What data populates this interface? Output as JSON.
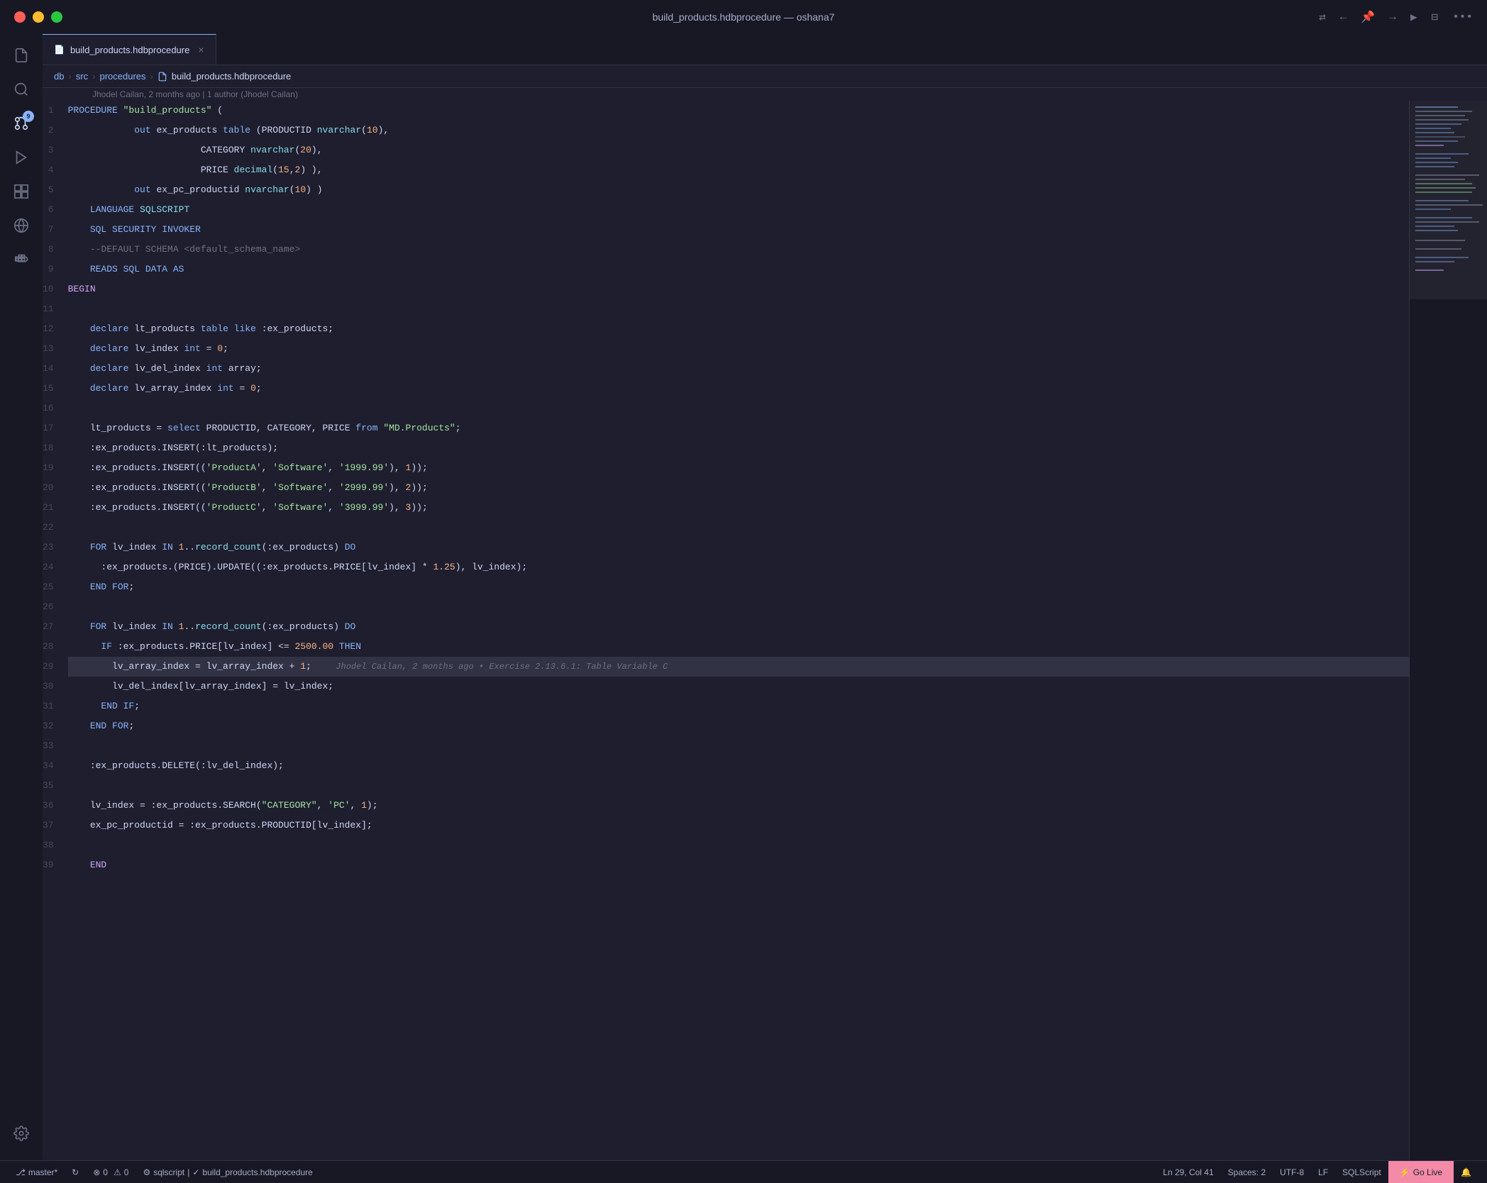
{
  "titlebar": {
    "title": "build_products.hdbprocedure — oshana7",
    "icons": [
      "git-compare",
      "go-back",
      "pin",
      "go-forward",
      "play",
      "split-editor",
      "more"
    ]
  },
  "activity_bar": {
    "icons": [
      {
        "name": "files",
        "symbol": "⎗",
        "active": false
      },
      {
        "name": "search",
        "symbol": "🔍",
        "active": false
      },
      {
        "name": "source-control",
        "symbol": "⎇",
        "active": true,
        "badge": "9"
      },
      {
        "name": "run-debug",
        "symbol": "▶",
        "active": false
      },
      {
        "name": "extensions",
        "symbol": "⊞",
        "active": false
      },
      {
        "name": "remote-explorer",
        "symbol": "○",
        "active": false
      },
      {
        "name": "docker",
        "symbol": "🐳",
        "active": false
      }
    ],
    "bottom_icons": [
      {
        "name": "settings",
        "symbol": "⚙"
      }
    ]
  },
  "tab": {
    "filename": "build_products.hdbprocedure",
    "icon": "📄",
    "modified": false
  },
  "breadcrumb": {
    "items": [
      "db",
      "src",
      "procedures",
      "build_products.hdbprocedure"
    ]
  },
  "blame": {
    "text": "Jhodel Cailan, 2 months ago | 1 author (Jhodel Cailan)"
  },
  "code": {
    "lines": [
      {
        "num": 1,
        "tokens": [
          {
            "t": "kw",
            "v": "PROCEDURE "
          },
          {
            "t": "str",
            "v": "\"build_products\""
          },
          {
            "t": "plain",
            "v": " ("
          }
        ]
      },
      {
        "num": 2,
        "tokens": [
          {
            "t": "plain",
            "v": "            "
          },
          {
            "t": "kw",
            "v": "out "
          },
          {
            "t": "plain",
            "v": "ex_products "
          },
          {
            "t": "kw",
            "v": "table "
          },
          {
            "t": "plain",
            "v": "(PRODUCTID "
          },
          {
            "t": "fn",
            "v": "nvarchar"
          },
          {
            "t": "plain",
            "v": "("
          },
          {
            "t": "num",
            "v": "10"
          },
          {
            "t": "plain",
            "v": "),"
          }
        ]
      },
      {
        "num": 3,
        "tokens": [
          {
            "t": "plain",
            "v": "                        CATEGORY "
          },
          {
            "t": "fn",
            "v": "nvarchar"
          },
          {
            "t": "plain",
            "v": "("
          },
          {
            "t": "num",
            "v": "20"
          },
          {
            "t": "plain",
            "v": "),"
          }
        ]
      },
      {
        "num": 4,
        "tokens": [
          {
            "t": "plain",
            "v": "                        PRICE "
          },
          {
            "t": "fn",
            "v": "decimal"
          },
          {
            "t": "plain",
            "v": "("
          },
          {
            "t": "num",
            "v": "15"
          },
          {
            "t": "plain",
            "v": ","
          },
          {
            "t": "num",
            "v": "2"
          },
          {
            "t": "plain",
            "v": "} ),"
          }
        ]
      },
      {
        "num": 5,
        "tokens": [
          {
            "t": "plain",
            "v": "            "
          },
          {
            "t": "kw",
            "v": "out "
          },
          {
            "t": "plain",
            "v": "ex_pc_productid "
          },
          {
            "t": "fn",
            "v": "nvarchar"
          },
          {
            "t": "plain",
            "v": "("
          },
          {
            "t": "num",
            "v": "10"
          },
          {
            "t": "plain",
            "v": "} )"
          }
        ]
      },
      {
        "num": 6,
        "tokens": [
          {
            "t": "kw",
            "v": "    LANGUAGE "
          },
          {
            "t": "fn",
            "v": "SQLSCRIPT"
          }
        ]
      },
      {
        "num": 7,
        "tokens": [
          {
            "t": "kw",
            "v": "    SQL SECURITY INVOKER"
          }
        ]
      },
      {
        "num": 8,
        "tokens": [
          {
            "t": "comment",
            "v": "    --DEFAULT SCHEMA <default_schema_name>"
          }
        ]
      },
      {
        "num": 9,
        "tokens": [
          {
            "t": "kw",
            "v": "    READS SQL DATA AS"
          }
        ]
      },
      {
        "num": 10,
        "tokens": [
          {
            "t": "kw2",
            "v": "BEGIN"
          }
        ]
      },
      {
        "num": 11,
        "tokens": []
      },
      {
        "num": 12,
        "tokens": [
          {
            "t": "kw",
            "v": "    declare "
          },
          {
            "t": "plain",
            "v": "lt_products "
          },
          {
            "t": "kw",
            "v": "table like "
          },
          {
            "t": "plain",
            "v": ":ex_products;"
          }
        ]
      },
      {
        "num": 13,
        "tokens": [
          {
            "t": "kw",
            "v": "    declare "
          },
          {
            "t": "plain",
            "v": "lv_index "
          },
          {
            "t": "kw",
            "v": "int "
          },
          {
            "t": "plain",
            "v": "= "
          },
          {
            "t": "num",
            "v": "0"
          },
          {
            "t": "plain",
            "v": ";"
          }
        ]
      },
      {
        "num": 14,
        "tokens": [
          {
            "t": "kw",
            "v": "    declare "
          },
          {
            "t": "plain",
            "v": "lv_del_index "
          },
          {
            "t": "kw",
            "v": "int "
          },
          {
            "t": "plain",
            "v": "array;"
          }
        ]
      },
      {
        "num": 15,
        "tokens": [
          {
            "t": "kw",
            "v": "    declare "
          },
          {
            "t": "plain",
            "v": "lv_array_index "
          },
          {
            "t": "kw",
            "v": "int "
          },
          {
            "t": "plain",
            "v": "= "
          },
          {
            "t": "num",
            "v": "0"
          },
          {
            "t": "plain",
            "v": ";"
          }
        ]
      },
      {
        "num": 16,
        "tokens": []
      },
      {
        "num": 17,
        "tokens": [
          {
            "t": "plain",
            "v": "    lt_products = "
          },
          {
            "t": "kw",
            "v": "select "
          },
          {
            "t": "plain",
            "v": "PRODUCTID, CATEGORY, PRICE "
          },
          {
            "t": "kw",
            "v": "from "
          },
          {
            "t": "str",
            "v": "\"MD.Products\""
          },
          {
            "t": "plain",
            "v": ";"
          }
        ]
      },
      {
        "num": 18,
        "tokens": [
          {
            "t": "plain",
            "v": "    :ex_products.INSERT(:lt_products);"
          }
        ]
      },
      {
        "num": 19,
        "tokens": [
          {
            "t": "plain",
            "v": "    :ex_products.INSERT(("
          },
          {
            "t": "str",
            "v": "'ProductA'"
          },
          {
            "t": "plain",
            "v": ", "
          },
          {
            "t": "str",
            "v": "'Software'"
          },
          {
            "t": "plain",
            "v": ", "
          },
          {
            "t": "str",
            "v": "'1999.99'"
          },
          {
            "t": "plain",
            "v": "}, "
          },
          {
            "t": "num",
            "v": "1"
          },
          {
            "t": "plain",
            "v": "));"
          }
        ]
      },
      {
        "num": 20,
        "tokens": [
          {
            "t": "plain",
            "v": "    :ex_products.INSERT(("
          },
          {
            "t": "str",
            "v": "'ProductB'"
          },
          {
            "t": "plain",
            "v": ", "
          },
          {
            "t": "str",
            "v": "'Software'"
          },
          {
            "t": "plain",
            "v": ", "
          },
          {
            "t": "str",
            "v": "'2999.99'"
          },
          {
            "t": "plain",
            "v": "}, "
          },
          {
            "t": "num",
            "v": "2"
          },
          {
            "t": "plain",
            "v": "));"
          }
        ]
      },
      {
        "num": 21,
        "tokens": [
          {
            "t": "plain",
            "v": "    :ex_products.INSERT(("
          },
          {
            "t": "str",
            "v": "'ProductC'"
          },
          {
            "t": "plain",
            "v": ", "
          },
          {
            "t": "str",
            "v": "'Software'"
          },
          {
            "t": "plain",
            "v": ", "
          },
          {
            "t": "str",
            "v": "'3999.99'"
          },
          {
            "t": "plain",
            "v": "}, "
          },
          {
            "t": "num",
            "v": "3"
          },
          {
            "t": "plain",
            "v": "));"
          }
        ]
      },
      {
        "num": 22,
        "tokens": []
      },
      {
        "num": 23,
        "tokens": [
          {
            "t": "kw",
            "v": "    FOR "
          },
          {
            "t": "plain",
            "v": "lv_index "
          },
          {
            "t": "kw",
            "v": "IN "
          },
          {
            "t": "num",
            "v": "1"
          },
          {
            "t": "plain",
            "v": ".."
          },
          {
            "t": "fn",
            "v": "record_count"
          },
          {
            "t": "plain",
            "v": "(:ex_products) "
          },
          {
            "t": "kw",
            "v": "DO"
          }
        ]
      },
      {
        "num": 24,
        "tokens": [
          {
            "t": "plain",
            "v": "      :ex_products.(PRICE).UPDATE((:ex_products.PRICE[lv_index] * "
          },
          {
            "t": "num",
            "v": "1.25"
          },
          {
            "t": "plain",
            "v": "}, lv_index);"
          }
        ]
      },
      {
        "num": 25,
        "tokens": [
          {
            "t": "kw",
            "v": "    END FOR"
          },
          {
            "t": "plain",
            "v": ";"
          }
        ]
      },
      {
        "num": 26,
        "tokens": []
      },
      {
        "num": 27,
        "tokens": [
          {
            "t": "kw",
            "v": "    FOR "
          },
          {
            "t": "plain",
            "v": "lv_index "
          },
          {
            "t": "kw",
            "v": "IN "
          },
          {
            "t": "num",
            "v": "1"
          },
          {
            "t": "plain",
            "v": ".."
          },
          {
            "t": "fn",
            "v": "record_count"
          },
          {
            "t": "plain",
            "v": "(:ex_products) "
          },
          {
            "t": "kw",
            "v": "DO"
          }
        ]
      },
      {
        "num": 28,
        "tokens": [
          {
            "t": "kw",
            "v": "      IF "
          },
          {
            "t": "plain",
            "v": ":ex_products.PRICE[lv_index] <= "
          },
          {
            "t": "num",
            "v": "2500.00"
          },
          {
            "t": "plain",
            "v": " "
          },
          {
            "t": "kw",
            "v": "THEN"
          }
        ]
      },
      {
        "num": 29,
        "tokens": [
          {
            "t": "plain",
            "v": "        lv_array_index = lv_array_index + "
          },
          {
            "t": "num",
            "v": "1"
          },
          {
            "t": "plain",
            "v": ";"
          },
          {
            "t": "blame",
            "v": "  Jhodel Cailan, 2 months ago • Exercise 2.13.6.1: Table Variable C"
          }
        ],
        "highlighted": true
      },
      {
        "num": 30,
        "tokens": [
          {
            "t": "plain",
            "v": "        lv_del_index[lv_array_index] = lv_index;"
          }
        ]
      },
      {
        "num": 31,
        "tokens": [
          {
            "t": "kw",
            "v": "      END IF"
          },
          {
            "t": "plain",
            "v": ";"
          }
        ]
      },
      {
        "num": 32,
        "tokens": [
          {
            "t": "kw",
            "v": "    END FOR"
          },
          {
            "t": "plain",
            "v": ";"
          }
        ]
      },
      {
        "num": 33,
        "tokens": []
      },
      {
        "num": 34,
        "tokens": [
          {
            "t": "plain",
            "v": "    :ex_products.DELETE(:lv_del_index);"
          }
        ]
      },
      {
        "num": 35,
        "tokens": []
      },
      {
        "num": 36,
        "tokens": [
          {
            "t": "plain",
            "v": "    lv_index = :ex_products.SEARCH("
          },
          {
            "t": "str",
            "v": "\"CATEGORY\""
          },
          {
            "t": "plain",
            "v": ", "
          },
          {
            "t": "str",
            "v": "'PC'"
          },
          {
            "t": "plain",
            "v": ", "
          },
          {
            "t": "num",
            "v": "1"
          },
          {
            "t": "plain",
            "v": "};"
          }
        ]
      },
      {
        "num": 37,
        "tokens": [
          {
            "t": "plain",
            "v": "    ex_pc_productid = :ex_products.PRODUCTID[lv_index];"
          }
        ]
      },
      {
        "num": 38,
        "tokens": []
      },
      {
        "num": 39,
        "tokens": [
          {
            "t": "kw2",
            "v": "    END"
          }
        ]
      }
    ]
  },
  "status_bar": {
    "branch": "master*",
    "errors": "0",
    "warnings": "0",
    "language_check": "sqlscript",
    "file_check": "build_products.hdbprocedure",
    "position": "Ln 29, Col 41",
    "spaces": "Spaces: 2",
    "encoding": "UTF-8",
    "eol": "LF",
    "language": "SQLScript",
    "go_live": "Go Live"
  }
}
